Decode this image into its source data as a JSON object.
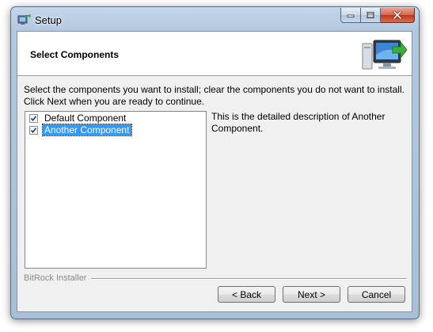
{
  "window": {
    "title": "Setup"
  },
  "header": {
    "title": "Select Components"
  },
  "intro": {
    "text": "Select the components you want to install; clear the components you do not want to install. Click Next when you are ready to continue."
  },
  "components": [
    {
      "label": "Default Component",
      "checked": true,
      "selected": false
    },
    {
      "label": "Another Component",
      "checked": true,
      "selected": true
    }
  ],
  "description": {
    "text": "This is the detailed description of Another Component."
  },
  "footer": {
    "brand": "BitRock Installer"
  },
  "buttons": {
    "back": "< Back",
    "next": "Next >",
    "cancel": "Cancel"
  },
  "colors": {
    "selection": "#3399ff",
    "close_button": "#c2331a",
    "client_background": "#f0f0f0"
  },
  "icons": {
    "app": "installer-app-icon",
    "header": "computer-with-green-arrow-icon",
    "minimize": "minimize-icon",
    "maximize": "maximize-icon",
    "close": "close-icon",
    "check": "checkmark-icon"
  }
}
